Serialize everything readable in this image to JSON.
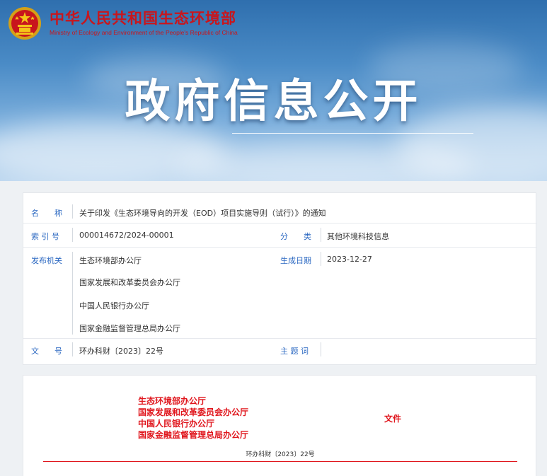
{
  "header": {
    "org_name_cn": "中华人民共和国生态环境部",
    "org_name_en": "Ministry of Ecology and Environment of the People's Republic of China",
    "banner_title": "政府信息公开"
  },
  "info": {
    "name_label": "名　　称",
    "name_value": "关于印发《生态环境导向的开发（EOD）项目实施导则（试行）》的通知",
    "index_label": "索 引 号",
    "index_value": "000014672/2024-00001",
    "category_label": "分　　类",
    "category_value": "其他环境科技信息",
    "issuer_label": "发布机关",
    "issuers": [
      "生态环境部办公厅",
      "国家发展和改革委员会办公厅",
      "中国人民银行办公厅",
      "国家金融监督管理总局办公厅"
    ],
    "date_label": "生成日期",
    "date_value": "2023-12-27",
    "docno_label": "文　　号",
    "docno_value": "环办科财〔2023〕22号",
    "keywords_label": "主 题 词",
    "keywords_value": ""
  },
  "document": {
    "issuing_orgs": [
      "生态环境部办公厅",
      "国家发展和改革委员会办公厅",
      "中国人民银行办公厅",
      "国家金融监督管理总局办公厅"
    ],
    "doc_kind": "文件",
    "doc_number": "环办科财〔2023〕22号"
  },
  "colors": {
    "brand_red": "#c8161d",
    "label_blue": "#2c69c2"
  }
}
